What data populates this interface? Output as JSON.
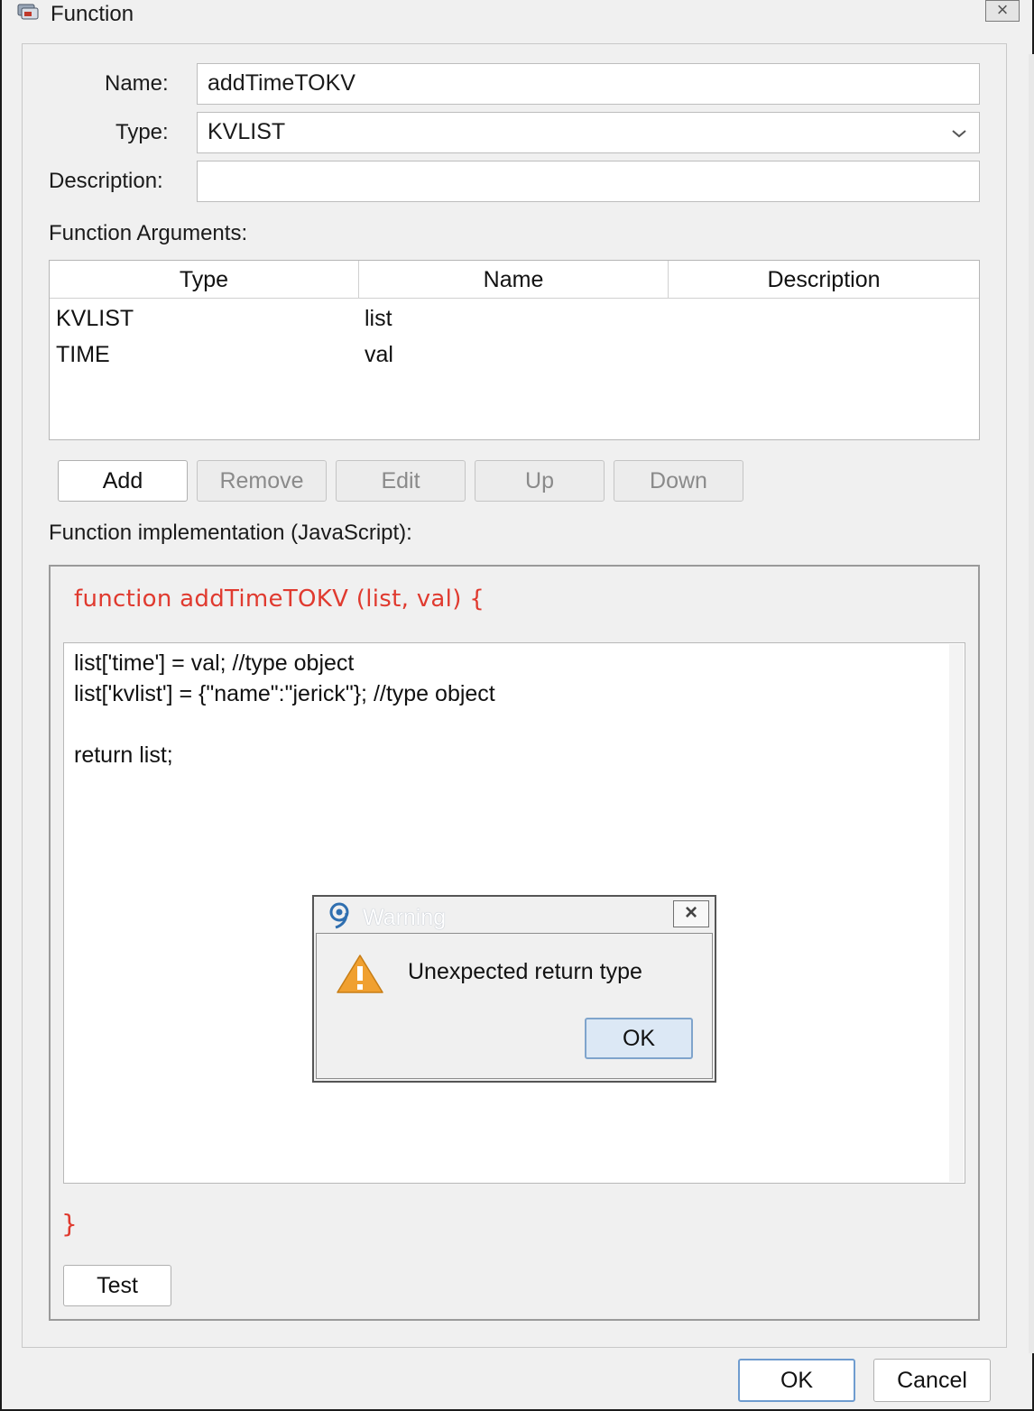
{
  "window": {
    "title": "Function",
    "close_glyph": "×"
  },
  "form": {
    "name_label": "Name:",
    "name_value": "addTimeTOKV",
    "type_label": "Type:",
    "type_value": "KVLIST",
    "description_label": "Description:",
    "description_value": ""
  },
  "arguments": {
    "section_label": "Function Arguments:",
    "columns": [
      "Type",
      "Name",
      "Description"
    ],
    "rows": [
      {
        "type": "KVLIST",
        "name": "list",
        "description": ""
      },
      {
        "type": "TIME",
        "name": "val",
        "description": ""
      }
    ],
    "buttons": {
      "add": "Add",
      "remove": "Remove",
      "edit": "Edit",
      "up": "Up",
      "down": "Down"
    }
  },
  "implementation": {
    "section_label": "Function implementation (JavaScript):",
    "header": "function addTimeTOKV (list, val) {",
    "code_lines": [
      "list['time'] = val; //type object",
      "list['kvlist'] = {\"name\":\"jerick\"}; //type object",
      "",
      "return list;"
    ],
    "closing_brace": "}",
    "test_button": "Test"
  },
  "warning": {
    "title": "Warning",
    "message": "Unexpected return type",
    "ok_button": "OK",
    "close_glyph": "×"
  },
  "footer": {
    "ok_button": "OK",
    "cancel_button": "Cancel"
  },
  "colors": {
    "accent_red": "#e03a2f",
    "focus_blue": "#6f9ccf",
    "warning_orange": "#f0a030"
  }
}
